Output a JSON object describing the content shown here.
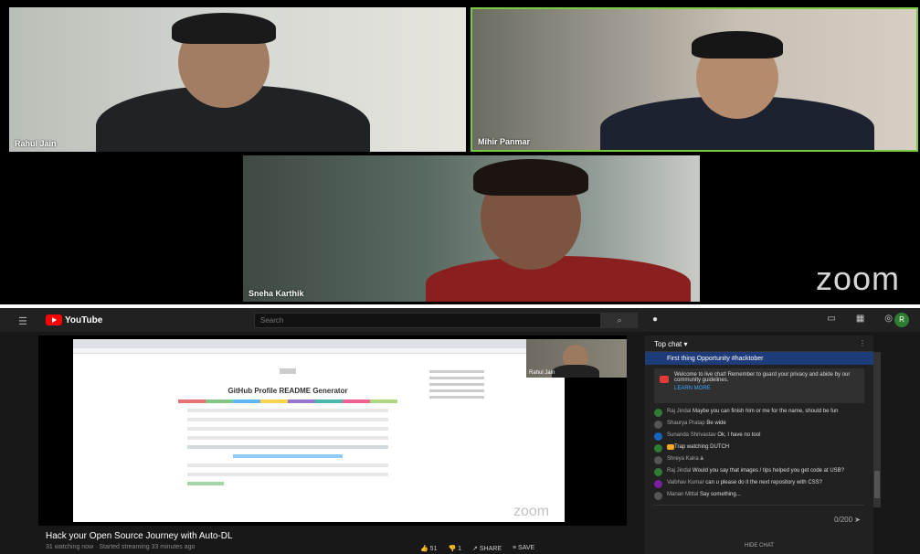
{
  "zoom": {
    "participants": [
      {
        "name": "Rahul Jain"
      },
      {
        "name": "Mihir Panmar"
      },
      {
        "name": "Sneha Karthik"
      }
    ],
    "brand": "zoom"
  },
  "youtube": {
    "logo": "YouTube",
    "search_placeholder": "Search",
    "search_icon": "search-icon",
    "video": {
      "title": "Hack your Open Source Journey with Auto-DL",
      "subtitle": "31 watching now · Started streaming 33 minutes ago",
      "screen_page_title": "GitHub Profile README Generator",
      "webcam_name": "Rahul Jain",
      "watermark": "zoom"
    },
    "actions": {
      "like": "51",
      "dislike": "1",
      "share": "SHARE",
      "save": "SAVE"
    },
    "chat": {
      "header": "Top chat",
      "pinned_badge": "",
      "pinned_text": "First thing Opportunity #hacktober",
      "welcome_text": "Welcome to live chat! Remember to guard your privacy and abide by our community guidelines.",
      "welcome_link": "LEARN MORE",
      "messages": [
        {
          "author": "Raj Jindal",
          "text": "Maybe you can finish him or me for the name, should be fun",
          "color": "#2e7d32"
        },
        {
          "author": "Shaurya Pratap",
          "text": "Be wide",
          "color": "#555555"
        },
        {
          "author": "Sunanda Shrivastav",
          "text": "Ok, I have no tool",
          "color": "#1565c0"
        },
        {
          "author": "",
          "text": "Trap watching DUTCH",
          "color": "#2e7d32",
          "badge": true
        },
        {
          "author": "Shreya Kalra",
          "text": "a",
          "color": "#555555"
        },
        {
          "author": "Raj Jindal",
          "text": "Would you say that images / tips helped you get code at USB?",
          "color": "#2e7d32"
        },
        {
          "author": "Vaibhav Kumar",
          "text": "can u please do it the next repository with CSS?",
          "color": "#7b1fa2"
        },
        {
          "author": "Manan Mittal",
          "text": "Say something...",
          "color": "#555555"
        }
      ],
      "input_counter": "0/200",
      "hide_chat": "HIDE CHAT"
    }
  }
}
